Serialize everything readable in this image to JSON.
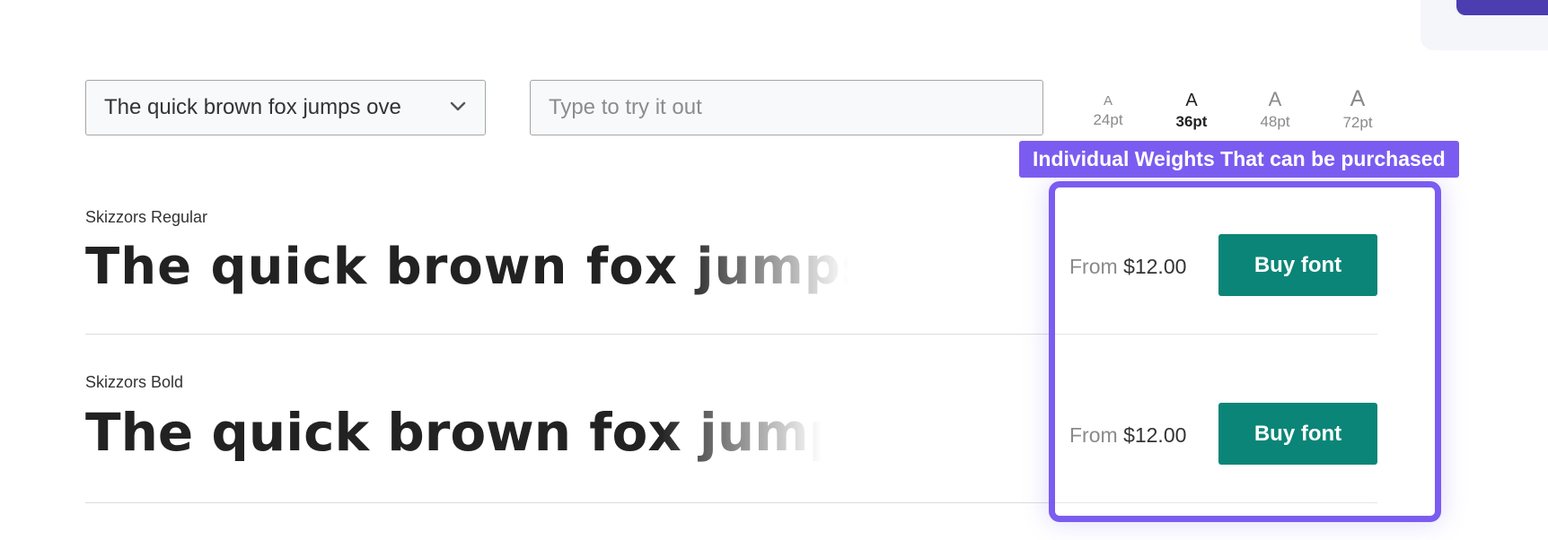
{
  "sample_text": {
    "selected": "The quick brown fox jumps ove"
  },
  "try_it": {
    "placeholder": "Type to try it out",
    "value": ""
  },
  "sizes": [
    {
      "glyph": "A",
      "label": "24pt",
      "active": false
    },
    {
      "glyph": "A",
      "label": "36pt",
      "active": true
    },
    {
      "glyph": "A",
      "label": "48pt",
      "active": false
    },
    {
      "glyph": "A",
      "label": "72pt",
      "active": false
    }
  ],
  "annotation": {
    "label": "Individual Weights That can be purchased",
    "color": "#7b5cf0"
  },
  "fonts": [
    {
      "name": "Skizzors Regular",
      "sample": "The quick brown fox jumps ove",
      "price_prefix": "From",
      "price": "$12.00",
      "button_label": "Buy font"
    },
    {
      "name": "Skizzors Bold",
      "sample": "The quick brown fox jumps",
      "price_prefix": "From",
      "price": "$12.00",
      "button_label": "Buy font"
    }
  ],
  "colors": {
    "buy_button": "#0b8577",
    "corner_button": "#4c3db0"
  },
  "icons": {
    "dropdown": "chevron-down-icon"
  }
}
